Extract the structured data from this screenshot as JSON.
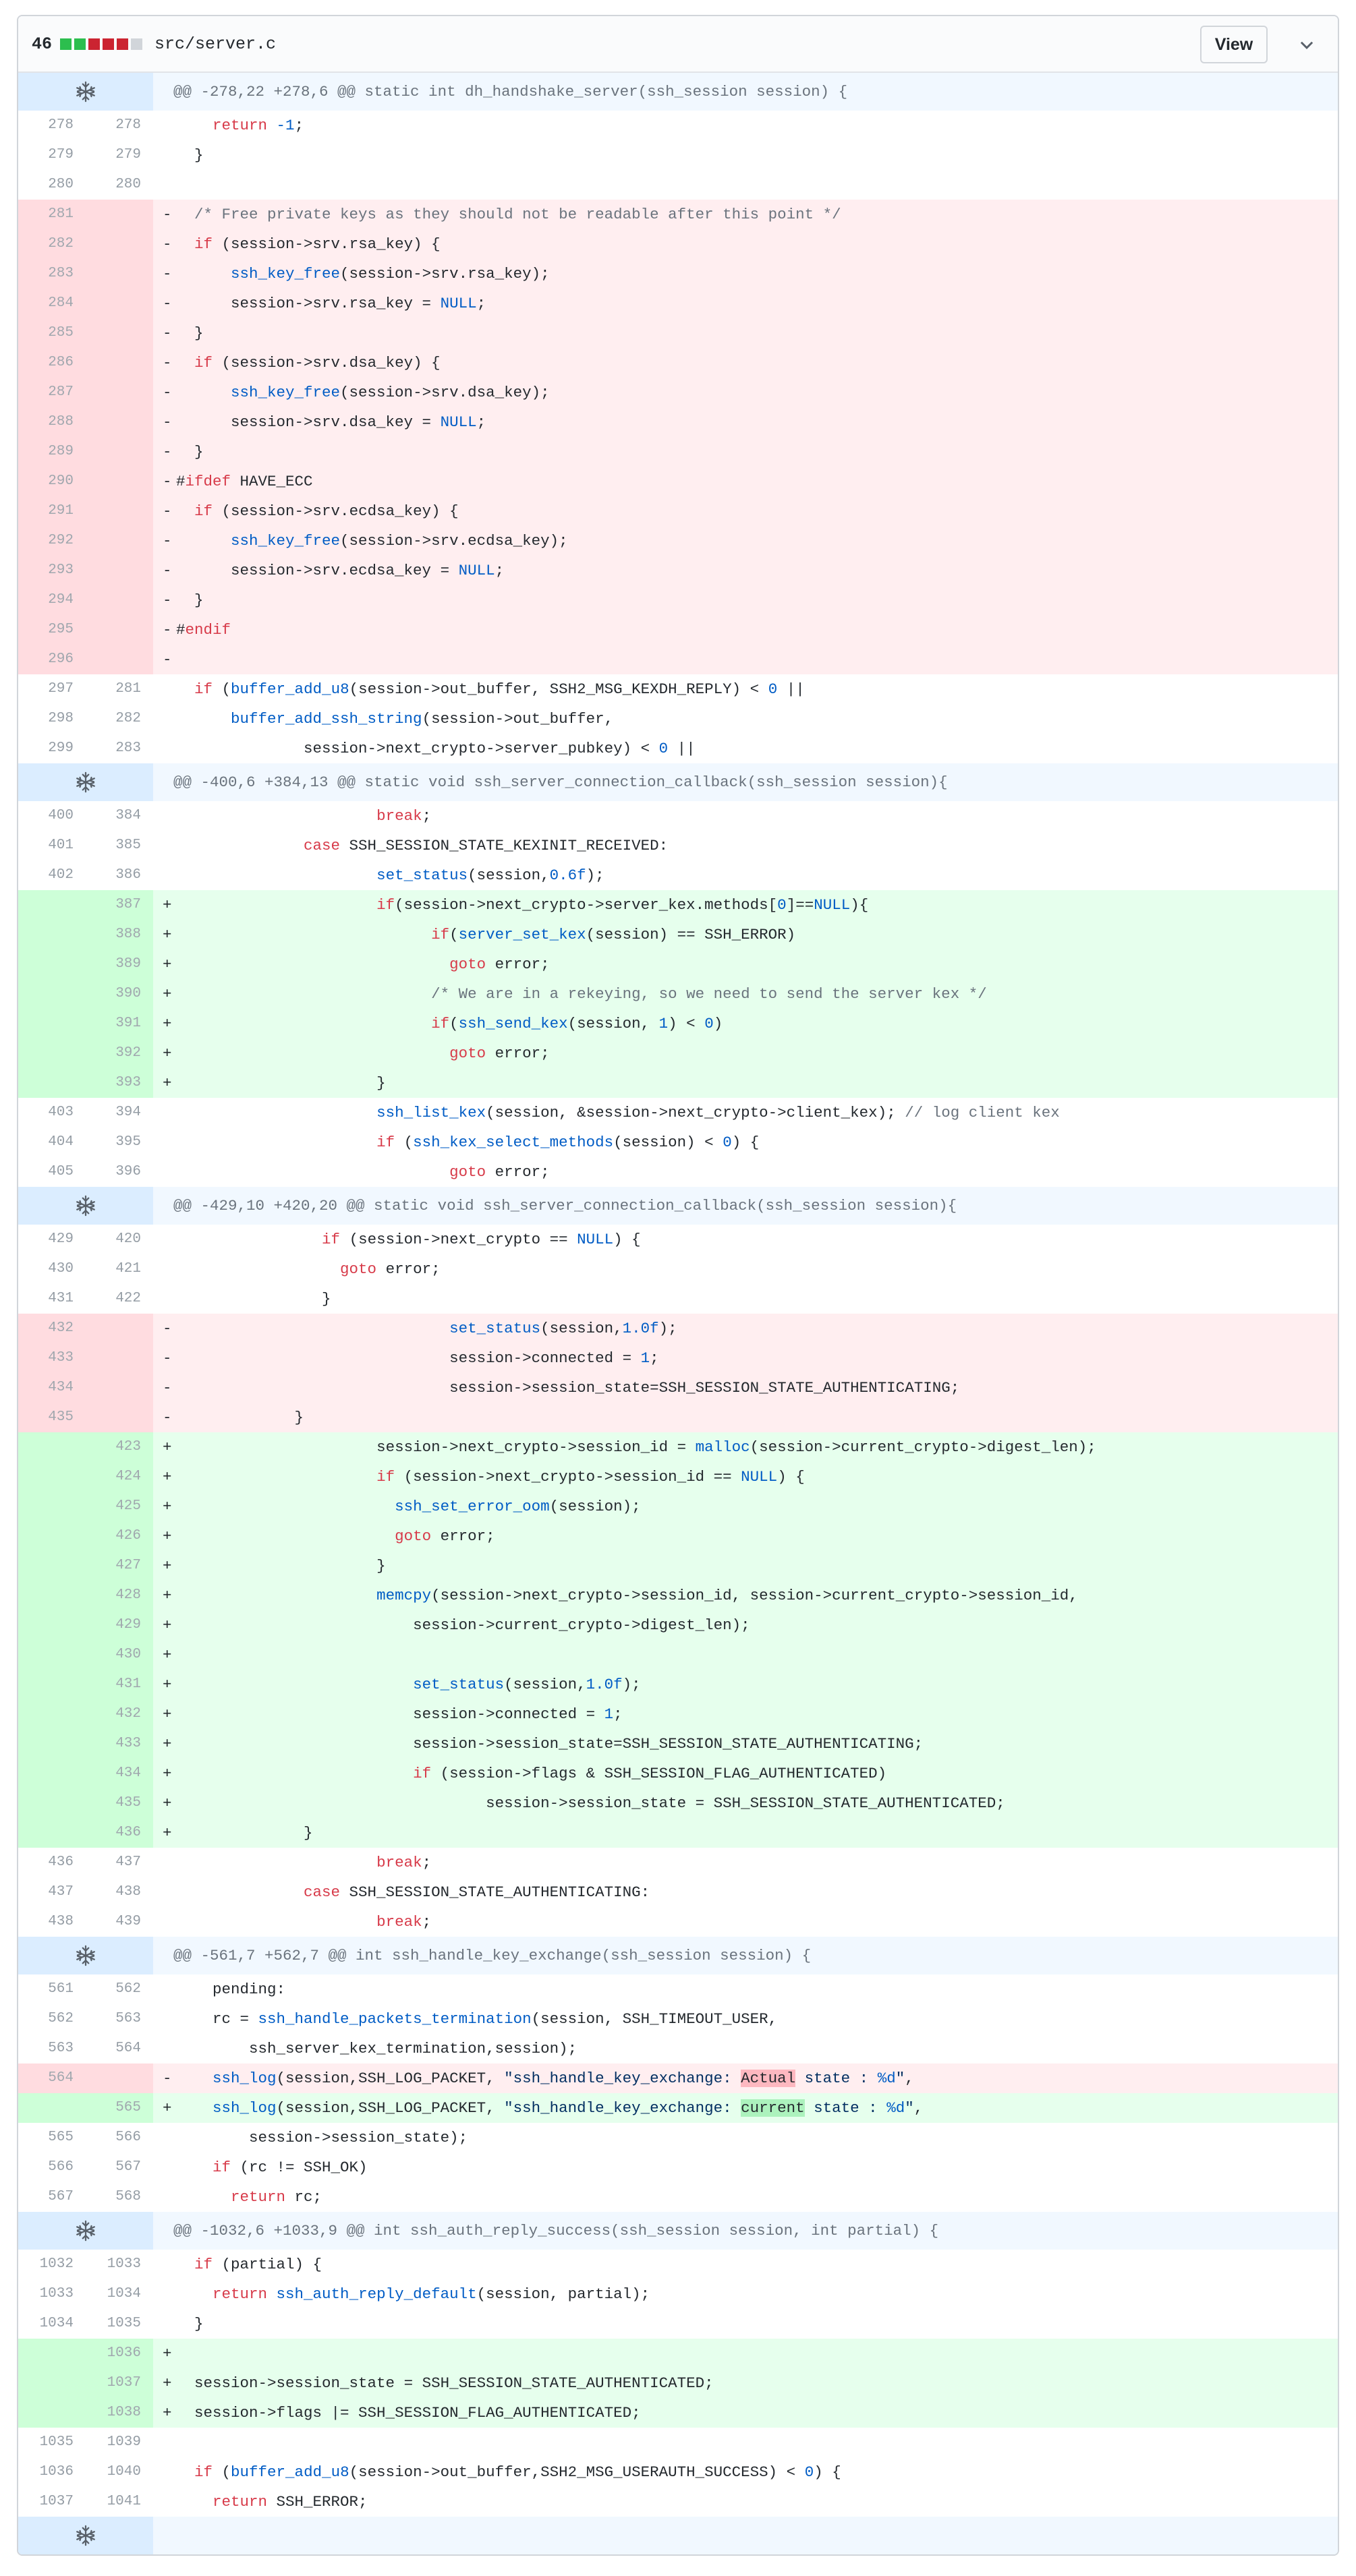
{
  "file": {
    "change_count": "46",
    "name": "src/server.c",
    "view_label": "View",
    "diffstat_colors": [
      "#2cbe4e",
      "#2cbe4e",
      "#cb2431",
      "#cb2431",
      "#cb2431",
      "#d1d5da"
    ]
  },
  "colors": {
    "keyword": "#d73a49",
    "function": "#005cc5",
    "comment": "#6a737d",
    "del_bg": "#ffeef0",
    "add_bg": "#e6ffed",
    "hunk_bg": "#f1f8ff"
  },
  "rows": [
    {
      "t": "hunk",
      "h": "@@ -278,22 +278,6 @@ static int dh_handshake_server(ssh_session session) {"
    },
    {
      "t": "ctx",
      "o": "278",
      "n": "278",
      "i": 4,
      "seg": [
        [
          "k",
          "return"
        ],
        [
          "p",
          " "
        ],
        [
          "n",
          "-1"
        ],
        [
          "p",
          ";"
        ]
      ]
    },
    {
      "t": "ctx",
      "o": "279",
      "n": "279",
      "i": 2,
      "seg": [
        [
          "p",
          "}"
        ]
      ]
    },
    {
      "t": "ctx",
      "o": "280",
      "n": "280",
      "i": 0,
      "seg": []
    },
    {
      "t": "del",
      "o": "281",
      "i": 2,
      "seg": [
        [
          "c",
          "/* Free private keys as they should not be readable after this point */"
        ]
      ]
    },
    {
      "t": "del",
      "o": "282",
      "i": 2,
      "seg": [
        [
          "k",
          "if"
        ],
        [
          "p",
          " (session->srv.rsa_key) {"
        ]
      ]
    },
    {
      "t": "del",
      "o": "283",
      "i": 6,
      "seg": [
        [
          "f",
          "ssh_key_free"
        ],
        [
          "p",
          "(session->srv.rsa_key);"
        ]
      ]
    },
    {
      "t": "del",
      "o": "284",
      "i": 6,
      "seg": [
        [
          "p",
          "session->srv.rsa_key = "
        ],
        [
          "n",
          "NULL"
        ],
        [
          "p",
          ";"
        ]
      ]
    },
    {
      "t": "del",
      "o": "285",
      "i": 2,
      "seg": [
        [
          "p",
          "}"
        ]
      ]
    },
    {
      "t": "del",
      "o": "286",
      "i": 2,
      "seg": [
        [
          "k",
          "if"
        ],
        [
          "p",
          " (session->srv.dsa_key) {"
        ]
      ]
    },
    {
      "t": "del",
      "o": "287",
      "i": 6,
      "seg": [
        [
          "f",
          "ssh_key_free"
        ],
        [
          "p",
          "(session->srv.dsa_key);"
        ]
      ]
    },
    {
      "t": "del",
      "o": "288",
      "i": 6,
      "seg": [
        [
          "p",
          "session->srv.dsa_key = "
        ],
        [
          "n",
          "NULL"
        ],
        [
          "p",
          ";"
        ]
      ]
    },
    {
      "t": "del",
      "o": "289",
      "i": 2,
      "seg": [
        [
          "p",
          "}"
        ]
      ]
    },
    {
      "t": "del",
      "o": "290",
      "i": 0,
      "seg": [
        [
          "p",
          "#"
        ],
        [
          "k",
          "ifdef"
        ],
        [
          "p",
          " HAVE_ECC"
        ]
      ]
    },
    {
      "t": "del",
      "o": "291",
      "i": 2,
      "seg": [
        [
          "k",
          "if"
        ],
        [
          "p",
          " (session->srv.ecdsa_key) {"
        ]
      ]
    },
    {
      "t": "del",
      "o": "292",
      "i": 6,
      "seg": [
        [
          "f",
          "ssh_key_free"
        ],
        [
          "p",
          "(session->srv.ecdsa_key);"
        ]
      ]
    },
    {
      "t": "del",
      "o": "293",
      "i": 6,
      "seg": [
        [
          "p",
          "session->srv.ecdsa_key = "
        ],
        [
          "n",
          "NULL"
        ],
        [
          "p",
          ";"
        ]
      ]
    },
    {
      "t": "del",
      "o": "294",
      "i": 2,
      "seg": [
        [
          "p",
          "}"
        ]
      ]
    },
    {
      "t": "del",
      "o": "295",
      "i": 0,
      "seg": [
        [
          "p",
          "#"
        ],
        [
          "k",
          "endif"
        ]
      ]
    },
    {
      "t": "del",
      "o": "296",
      "i": 0,
      "seg": []
    },
    {
      "t": "ctx",
      "o": "297",
      "n": "281",
      "i": 2,
      "seg": [
        [
          "k",
          "if"
        ],
        [
          "p",
          " ("
        ],
        [
          "f",
          "buffer_add_u8"
        ],
        [
          "p",
          "(session->out_buffer, SSH2_MSG_KEXDH_REPLY) < "
        ],
        [
          "n",
          "0"
        ],
        [
          "p",
          " ||"
        ]
      ]
    },
    {
      "t": "ctx",
      "o": "298",
      "n": "282",
      "i": 6,
      "seg": [
        [
          "f",
          "buffer_add_ssh_string"
        ],
        [
          "p",
          "(session->out_buffer,"
        ]
      ]
    },
    {
      "t": "ctx",
      "o": "299",
      "n": "283",
      "i": 14,
      "seg": [
        [
          "p",
          "session->next_crypto->server_pubkey) < "
        ],
        [
          "n",
          "0"
        ],
        [
          "p",
          " ||"
        ]
      ]
    },
    {
      "t": "hunk",
      "h": "@@ -400,6 +384,13 @@ static void ssh_server_connection_callback(ssh_session session){"
    },
    {
      "t": "ctx",
      "o": "400",
      "n": "384",
      "i": 22,
      "seg": [
        [
          "k",
          "break"
        ],
        [
          "p",
          ";"
        ]
      ]
    },
    {
      "t": "ctx",
      "o": "401",
      "n": "385",
      "i": 14,
      "seg": [
        [
          "k",
          "case"
        ],
        [
          "p",
          " SSH_SESSION_STATE_KEXINIT_RECEIVED:"
        ]
      ]
    },
    {
      "t": "ctx",
      "o": "402",
      "n": "386",
      "i": 22,
      "seg": [
        [
          "f",
          "set_status"
        ],
        [
          "p",
          "(session,"
        ],
        [
          "n",
          "0.6f"
        ],
        [
          "p",
          ");"
        ]
      ]
    },
    {
      "t": "add",
      "n": "387",
      "i": 22,
      "seg": [
        [
          "k",
          "if"
        ],
        [
          "p",
          "(session->next_crypto->server_kex.methods["
        ],
        [
          "n",
          "0"
        ],
        [
          "p",
          "]=="
        ],
        [
          "n",
          "NULL"
        ],
        [
          "p",
          "){"
        ]
      ]
    },
    {
      "t": "add",
      "n": "388",
      "i": 28,
      "seg": [
        [
          "k",
          "if"
        ],
        [
          "p",
          "("
        ],
        [
          "f",
          "server_set_kex"
        ],
        [
          "p",
          "(session) == SSH_ERROR)"
        ]
      ]
    },
    {
      "t": "add",
      "n": "389",
      "i": 30,
      "seg": [
        [
          "k",
          "goto"
        ],
        [
          "p",
          " error;"
        ]
      ]
    },
    {
      "t": "add",
      "n": "390",
      "i": 28,
      "seg": [
        [
          "c",
          "/* We are in a rekeying, so we need to send the server kex */"
        ]
      ]
    },
    {
      "t": "add",
      "n": "391",
      "i": 28,
      "seg": [
        [
          "k",
          "if"
        ],
        [
          "p",
          "("
        ],
        [
          "f",
          "ssh_send_kex"
        ],
        [
          "p",
          "(session, "
        ],
        [
          "n",
          "1"
        ],
        [
          "p",
          ") < "
        ],
        [
          "n",
          "0"
        ],
        [
          "p",
          ")"
        ]
      ]
    },
    {
      "t": "add",
      "n": "392",
      "i": 30,
      "seg": [
        [
          "k",
          "goto"
        ],
        [
          "p",
          " error;"
        ]
      ]
    },
    {
      "t": "add",
      "n": "393",
      "i": 22,
      "seg": [
        [
          "p",
          "}"
        ]
      ]
    },
    {
      "t": "ctx",
      "o": "403",
      "n": "394",
      "i": 22,
      "seg": [
        [
          "f",
          "ssh_list_kex"
        ],
        [
          "p",
          "(session, &session->next_crypto->client_kex); "
        ],
        [
          "c",
          "// log client kex"
        ]
      ]
    },
    {
      "t": "ctx",
      "o": "404",
      "n": "395",
      "i": 22,
      "seg": [
        [
          "k",
          "if"
        ],
        [
          "p",
          " ("
        ],
        [
          "f",
          "ssh_kex_select_methods"
        ],
        [
          "p",
          "(session) < "
        ],
        [
          "n",
          "0"
        ],
        [
          "p",
          ") {"
        ]
      ]
    },
    {
      "t": "ctx",
      "o": "405",
      "n": "396",
      "i": 30,
      "seg": [
        [
          "k",
          "goto"
        ],
        [
          "p",
          " error;"
        ]
      ]
    },
    {
      "t": "hunk",
      "h": "@@ -429,10 +420,20 @@ static void ssh_server_connection_callback(ssh_session session){"
    },
    {
      "t": "ctx",
      "o": "429",
      "n": "420",
      "i": 16,
      "seg": [
        [
          "k",
          "if"
        ],
        [
          "p",
          " (session->next_crypto == "
        ],
        [
          "n",
          "NULL"
        ],
        [
          "p",
          ") {"
        ]
      ]
    },
    {
      "t": "ctx",
      "o": "430",
      "n": "421",
      "i": 18,
      "seg": [
        [
          "k",
          "goto"
        ],
        [
          "p",
          " error;"
        ]
      ]
    },
    {
      "t": "ctx",
      "o": "431",
      "n": "422",
      "i": 16,
      "seg": [
        [
          "p",
          "}"
        ]
      ]
    },
    {
      "t": "del",
      "o": "432",
      "i": 30,
      "seg": [
        [
          "f",
          "set_status"
        ],
        [
          "p",
          "(session,"
        ],
        [
          "n",
          "1.0f"
        ],
        [
          "p",
          ");"
        ]
      ]
    },
    {
      "t": "del",
      "o": "433",
      "i": 30,
      "seg": [
        [
          "p",
          "session->connected = "
        ],
        [
          "n",
          "1"
        ],
        [
          "p",
          ";"
        ]
      ]
    },
    {
      "t": "del",
      "o": "434",
      "i": 30,
      "seg": [
        [
          "p",
          "session->session_state=SSH_SESSION_STATE_AUTHENTICATING;"
        ]
      ]
    },
    {
      "t": "del",
      "o": "435",
      "i": 13,
      "seg": [
        [
          "p",
          "}"
        ]
      ]
    },
    {
      "t": "add",
      "n": "423",
      "i": 22,
      "seg": [
        [
          "p",
          "session->next_crypto->session_id = "
        ],
        [
          "f",
          "malloc"
        ],
        [
          "p",
          "(session->current_crypto->digest_len);"
        ]
      ]
    },
    {
      "t": "add",
      "n": "424",
      "i": 22,
      "seg": [
        [
          "k",
          "if"
        ],
        [
          "p",
          " (session->next_crypto->session_id == "
        ],
        [
          "n",
          "NULL"
        ],
        [
          "p",
          ") {"
        ]
      ]
    },
    {
      "t": "add",
      "n": "425",
      "i": 24,
      "seg": [
        [
          "f",
          "ssh_set_error_oom"
        ],
        [
          "p",
          "(session);"
        ]
      ]
    },
    {
      "t": "add",
      "n": "426",
      "i": 24,
      "seg": [
        [
          "k",
          "goto"
        ],
        [
          "p",
          " error;"
        ]
      ]
    },
    {
      "t": "add",
      "n": "427",
      "i": 22,
      "seg": [
        [
          "p",
          "}"
        ]
      ]
    },
    {
      "t": "add",
      "n": "428",
      "i": 22,
      "seg": [
        [
          "f",
          "memcpy"
        ],
        [
          "p",
          "(session->next_crypto->session_id, session->current_crypto->session_id,"
        ]
      ]
    },
    {
      "t": "add",
      "n": "429",
      "i": 26,
      "seg": [
        [
          "p",
          "session->current_crypto->digest_len);"
        ]
      ]
    },
    {
      "t": "add",
      "n": "430",
      "i": 0,
      "seg": []
    },
    {
      "t": "add",
      "n": "431",
      "i": 26,
      "seg": [
        [
          "f",
          "set_status"
        ],
        [
          "p",
          "(session,"
        ],
        [
          "n",
          "1.0f"
        ],
        [
          "p",
          ");"
        ]
      ]
    },
    {
      "t": "add",
      "n": "432",
      "i": 26,
      "seg": [
        [
          "p",
          "session->connected = "
        ],
        [
          "n",
          "1"
        ],
        [
          "p",
          ";"
        ]
      ]
    },
    {
      "t": "add",
      "n": "433",
      "i": 26,
      "seg": [
        [
          "p",
          "session->session_state=SSH_SESSION_STATE_AUTHENTICATING;"
        ]
      ]
    },
    {
      "t": "add",
      "n": "434",
      "i": 26,
      "seg": [
        [
          "k",
          "if"
        ],
        [
          "p",
          " (session->flags & SSH_SESSION_FLAG_AUTHENTICATED)"
        ]
      ]
    },
    {
      "t": "add",
      "n": "435",
      "i": 34,
      "seg": [
        [
          "p",
          "session->session_state = SSH_SESSION_STATE_AUTHENTICATED;"
        ]
      ]
    },
    {
      "t": "add",
      "n": "436",
      "i": 14,
      "seg": [
        [
          "p",
          "}"
        ]
      ]
    },
    {
      "t": "ctx",
      "o": "436",
      "n": "437",
      "i": 22,
      "seg": [
        [
          "k",
          "break"
        ],
        [
          "p",
          ";"
        ]
      ]
    },
    {
      "t": "ctx",
      "o": "437",
      "n": "438",
      "i": 14,
      "seg": [
        [
          "k",
          "case"
        ],
        [
          "p",
          " SSH_SESSION_STATE_AUTHENTICATING:"
        ]
      ]
    },
    {
      "t": "ctx",
      "o": "438",
      "n": "439",
      "i": 22,
      "seg": [
        [
          "k",
          "break"
        ],
        [
          "p",
          ";"
        ]
      ]
    },
    {
      "t": "hunk",
      "h": "@@ -561,7 +562,7 @@ int ssh_handle_key_exchange(ssh_session session) {"
    },
    {
      "t": "ctx",
      "o": "561",
      "n": "562",
      "i": 4,
      "seg": [
        [
          "p",
          "pending:"
        ]
      ]
    },
    {
      "t": "ctx",
      "o": "562",
      "n": "563",
      "i": 4,
      "seg": [
        [
          "p",
          "rc = "
        ],
        [
          "f",
          "ssh_handle_packets_termination"
        ],
        [
          "p",
          "(session, SSH_TIMEOUT_USER,"
        ]
      ]
    },
    {
      "t": "ctx",
      "o": "563",
      "n": "564",
      "i": 8,
      "seg": [
        [
          "p",
          "ssh_server_kex_termination,session);"
        ]
      ]
    },
    {
      "t": "del",
      "o": "564",
      "i": 4,
      "seg": [
        [
          "f",
          "ssh_log"
        ],
        [
          "p",
          "(session,SSH_LOG_PACKET, "
        ],
        [
          "s",
          "\"ssh_handle_key_exchange: "
        ],
        [
          "hd",
          "Actual"
        ],
        [
          "s",
          " state : "
        ],
        [
          "n",
          "%d"
        ],
        [
          "s",
          "\""
        ],
        [
          "p",
          ","
        ]
      ]
    },
    {
      "t": "add",
      "n": "565",
      "i": 4,
      "seg": [
        [
          "f",
          "ssh_log"
        ],
        [
          "p",
          "(session,SSH_LOG_PACKET, "
        ],
        [
          "s",
          "\"ssh_handle_key_exchange: "
        ],
        [
          "ha",
          "current"
        ],
        [
          "s",
          " state : "
        ],
        [
          "n",
          "%d"
        ],
        [
          "s",
          "\""
        ],
        [
          "p",
          ","
        ]
      ]
    },
    {
      "t": "ctx",
      "o": "565",
      "n": "566",
      "i": 8,
      "seg": [
        [
          "p",
          "session->session_state);"
        ]
      ]
    },
    {
      "t": "ctx",
      "o": "566",
      "n": "567",
      "i": 4,
      "seg": [
        [
          "k",
          "if"
        ],
        [
          "p",
          " (rc != SSH_OK)"
        ]
      ]
    },
    {
      "t": "ctx",
      "o": "567",
      "n": "568",
      "i": 6,
      "seg": [
        [
          "k",
          "return"
        ],
        [
          "p",
          " rc;"
        ]
      ]
    },
    {
      "t": "hunk",
      "h": "@@ -1032,6 +1033,9 @@ int ssh_auth_reply_success(ssh_session session, int partial) {"
    },
    {
      "t": "ctx",
      "o": "1032",
      "n": "1033",
      "i": 2,
      "seg": [
        [
          "k",
          "if"
        ],
        [
          "p",
          " (partial) {"
        ]
      ]
    },
    {
      "t": "ctx",
      "o": "1033",
      "n": "1034",
      "i": 4,
      "seg": [
        [
          "k",
          "return"
        ],
        [
          "p",
          " "
        ],
        [
          "f",
          "ssh_auth_reply_default"
        ],
        [
          "p",
          "(session, partial);"
        ]
      ]
    },
    {
      "t": "ctx",
      "o": "1034",
      "n": "1035",
      "i": 2,
      "seg": [
        [
          "p",
          "}"
        ]
      ]
    },
    {
      "t": "add",
      "n": "1036",
      "i": 0,
      "seg": []
    },
    {
      "t": "add",
      "n": "1037",
      "i": 2,
      "seg": [
        [
          "p",
          "session->session_state = SSH_SESSION_STATE_AUTHENTICATED;"
        ]
      ]
    },
    {
      "t": "add",
      "n": "1038",
      "i": 2,
      "seg": [
        [
          "p",
          "session->flags |= SSH_SESSION_FLAG_AUTHENTICATED;"
        ]
      ]
    },
    {
      "t": "ctx",
      "o": "1035",
      "n": "1039",
      "i": 0,
      "seg": []
    },
    {
      "t": "ctx",
      "o": "1036",
      "n": "1040",
      "i": 2,
      "seg": [
        [
          "k",
          "if"
        ],
        [
          "p",
          " ("
        ],
        [
          "f",
          "buffer_add_u8"
        ],
        [
          "p",
          "(session->out_buffer,SSH2_MSG_USERAUTH_SUCCESS) < "
        ],
        [
          "n",
          "0"
        ],
        [
          "p",
          ") {"
        ]
      ]
    },
    {
      "t": "ctx",
      "o": "1037",
      "n": "1041",
      "i": 4,
      "seg": [
        [
          "k",
          "return"
        ],
        [
          "p",
          " SSH_ERROR;"
        ]
      ]
    },
    {
      "t": "hunk",
      "h": ""
    }
  ]
}
